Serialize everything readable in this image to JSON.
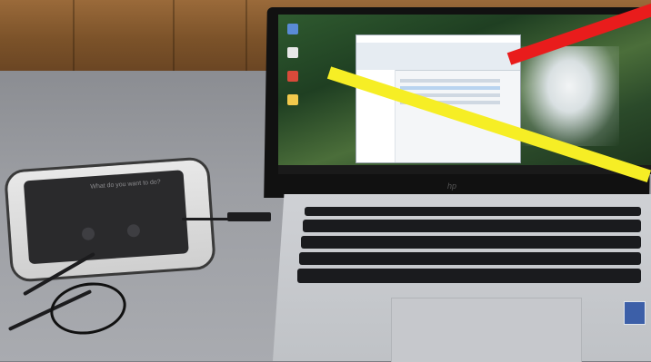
{
  "photo": {
    "tablet_prompt": "What do you want to do?",
    "laptop_brand": "hp",
    "annotation_colors": {
      "yellow_line": "#f6ee25",
      "red_line": "#e91c1c"
    }
  }
}
